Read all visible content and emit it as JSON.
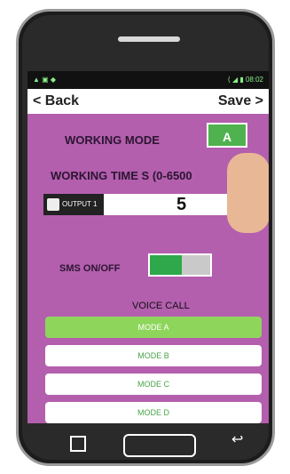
{
  "status": {
    "left_icons": "▲ ▣ ◆",
    "right": "⟨ ◢ ▮ 08:02"
  },
  "nav": {
    "back": "< Back",
    "save": "Save >"
  },
  "working_mode": {
    "label": "WORKING MODE",
    "value": "A"
  },
  "working_time": {
    "label": "WORKING TIME S (0-6500"
  },
  "output": {
    "label": "OUTPUT 1",
    "value": "5"
  },
  "sms": {
    "label": "SMS ON/OFF",
    "state": "on"
  },
  "voice_call": {
    "label": "VOICE CALL",
    "modes": [
      "MODE A",
      "MODE B",
      "MODE C",
      "MODE D"
    ]
  },
  "colors": {
    "screen": "#b35fae",
    "accent_green": "#4fb24f"
  }
}
